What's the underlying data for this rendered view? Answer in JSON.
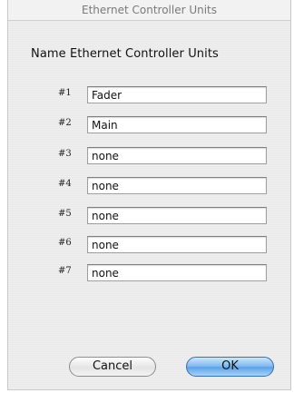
{
  "window": {
    "title": "Ethernet Controller Units"
  },
  "dialog": {
    "heading": "Name Ethernet Controller Units"
  },
  "units": [
    {
      "label": "#1",
      "value": "Fader"
    },
    {
      "label": "#2",
      "value": "Main"
    },
    {
      "label": "#3",
      "value": "none"
    },
    {
      "label": "#4",
      "value": "none"
    },
    {
      "label": "#5",
      "value": "none"
    },
    {
      "label": "#6",
      "value": "none"
    },
    {
      "label": "#7",
      "value": "none"
    }
  ],
  "buttons": {
    "cancel": "Cancel",
    "ok": "OK"
  },
  "colors": {
    "default_button": "#5aa0e8"
  }
}
